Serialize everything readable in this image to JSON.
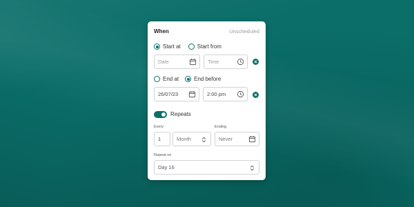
{
  "panel": {
    "title": "When",
    "status": "Unscheduled"
  },
  "start": {
    "options": [
      "Start at",
      "Start from"
    ],
    "selected": "Start at",
    "date_placeholder": "Date",
    "time_placeholder": "Time"
  },
  "end": {
    "options": [
      "End at",
      "End before"
    ],
    "selected": "End before",
    "date_value": "26/07/23",
    "time_value": "2:00 pm"
  },
  "repeats": {
    "label": "Repeats",
    "enabled": true,
    "every_label": "Every",
    "every_value": "1",
    "unit_value": "Month",
    "ending_label": "Ending",
    "ending_value": "Never",
    "repeat_on_label": "Repeat on",
    "repeat_on_value": "Day 16"
  },
  "colors": {
    "accent": "#0b6e69",
    "background": "#0b6e69",
    "card": "#ffffff"
  },
  "icons": [
    "calendar-icon",
    "clock-icon",
    "close-icon",
    "stepper-icon"
  ]
}
